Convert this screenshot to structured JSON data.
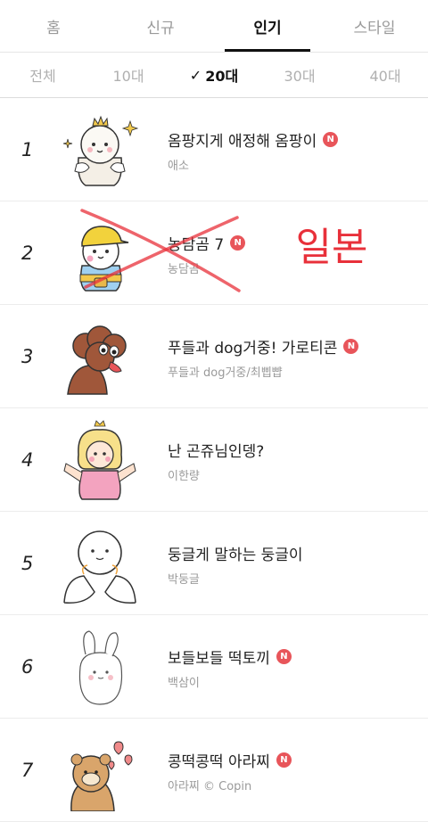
{
  "top_tabs": [
    "홈",
    "신규",
    "인기",
    "스타일"
  ],
  "active_top_tab": 2,
  "age_filters": [
    "전체",
    "10대",
    "20대",
    "30대",
    "40대"
  ],
  "active_age_filter": 2,
  "check_glyph": "✓",
  "new_badge": "N",
  "items": [
    {
      "rank": "1",
      "title": "옴팡지게 애정해 옴팡이",
      "author": "애소",
      "is_new": true
    },
    {
      "rank": "2",
      "title": "농담곰 7",
      "author": "농담곰",
      "is_new": true
    },
    {
      "rank": "3",
      "title": "푸들과 dog거중! 가로티콘",
      "author": "푸들과 dog거중/최삡뺩",
      "is_new": true
    },
    {
      "rank": "4",
      "title": "난 곤쥬님인뎅?",
      "author": "이한량",
      "is_new": false
    },
    {
      "rank": "5",
      "title": "둥글게 말하는 둥글이",
      "author": "박둥글",
      "is_new": false
    },
    {
      "rank": "6",
      "title": "보들보들 떡토끼",
      "author": "백삼이",
      "is_new": true
    },
    {
      "rank": "7",
      "title": "콩떡콩떡 아라찌",
      "author": "아라찌 © Copin",
      "is_new": true
    }
  ],
  "handwritten_note": "일본",
  "colors": {
    "badge": "#e8555a",
    "annotation": "#e8303a"
  }
}
